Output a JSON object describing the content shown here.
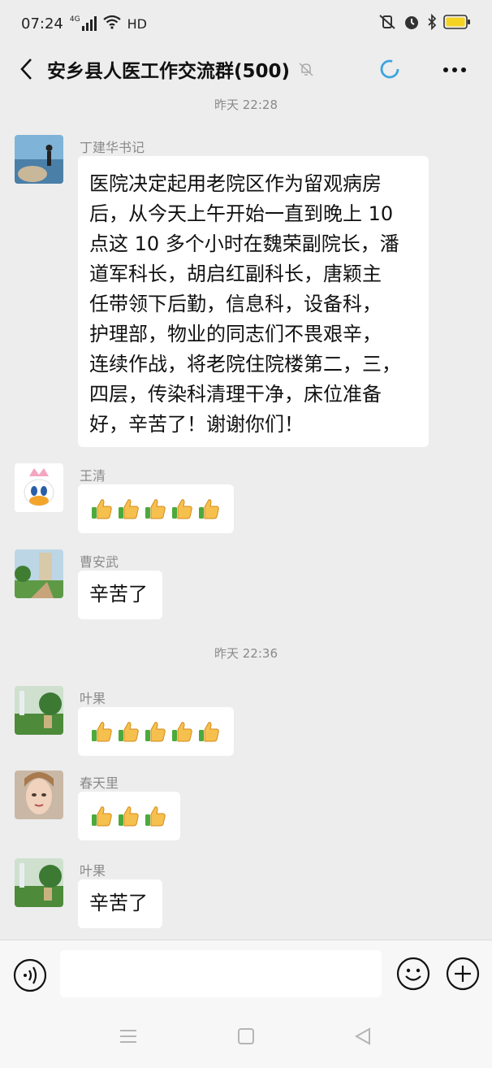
{
  "status_bar": {
    "time": "07:24",
    "network": "4G",
    "hd": "HD"
  },
  "header": {
    "title": "安乡县人医工作交流群(500)"
  },
  "timestamps": [
    "昨天 22:28",
    "昨天 22:36"
  ],
  "messages": [
    {
      "sender": "丁建华书记",
      "lines": [
        "医院决定起用老院区作为留观病房",
        "后，从今天上午开始一直到晚上 10",
        "点这 10 多个小时在魏荣副院长，潘",
        "道军科长，胡启红副科长，唐颖主",
        "任带领下后勤，信息科，设备科，",
        "护理部，物业的同志们不畏艰辛，",
        "连续作战，将老院住院楼第二，三，",
        "四层，传染科清理干净，床位准备",
        "好，辛苦了！谢谢你们！"
      ]
    },
    {
      "sender": "王清",
      "thumbs_count": 5
    },
    {
      "sender": "曹安武",
      "text": "辛苦了"
    },
    {
      "sender": "叶果",
      "thumbs_count": 5
    },
    {
      "sender": "春天里",
      "thumbs_count": 3
    },
    {
      "sender": "叶果",
      "text": "辛苦了"
    }
  ],
  "input": {
    "placeholder": ""
  },
  "colors": {
    "background": "#ededed",
    "bubble": "#ffffff",
    "accent_loading": "#3ba4e0",
    "battery": "#f5d323"
  }
}
